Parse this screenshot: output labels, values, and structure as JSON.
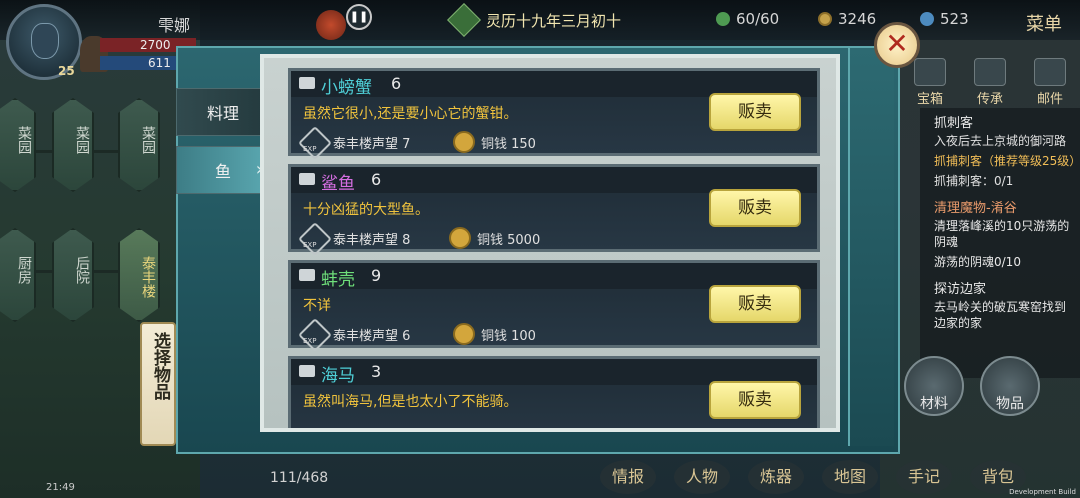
{
  "header": {
    "player_name": "雫娜",
    "level": "25",
    "hp": "2700",
    "mp": "611",
    "pause_icon": "pause-icon",
    "date": "灵历十九年三月初十",
    "resources": [
      {
        "icon": "stamina-icon",
        "value": "60/60"
      },
      {
        "icon": "coin-icon",
        "value": "3246"
      },
      {
        "icon": "spirit-icon",
        "value": "523"
      }
    ],
    "menu_label": "菜单"
  },
  "map": {
    "nodes": [
      "菜园",
      "菜园",
      "菜园",
      "厨房",
      "后院",
      "泰丰楼"
    ],
    "choose_label": "选择物品"
  },
  "modal": {
    "tabs": [
      {
        "label": "料理",
        "active": false
      },
      {
        "label": "鱼",
        "active": true
      }
    ],
    "items": [
      {
        "name": "小螃蟹",
        "qty": "6",
        "name_color": "#4fd0d8",
        "desc": "虽然它很小,还是要小心它的蟹钳。",
        "reputation": "泰丰楼声望 7",
        "price": "铜钱 150",
        "sell_label": "贩卖"
      },
      {
        "name": "鲨鱼",
        "qty": "6",
        "name_color": "#d46ee0",
        "desc": "十分凶猛的大型鱼。",
        "reputation": "泰丰楼声望 8",
        "price": "铜钱 5000",
        "sell_label": "贩卖"
      },
      {
        "name": "蚌壳",
        "qty": "9",
        "name_color": "#6fe07a",
        "desc": "不详",
        "reputation": "泰丰楼声望 6",
        "price": "铜钱 100",
        "sell_label": "贩卖"
      },
      {
        "name": "海马",
        "qty": "3",
        "name_color": "#4fd0d8",
        "desc": "虽然叫海马,但是也太小了不能骑。",
        "reputation": "",
        "price": "",
        "sell_label": "贩卖"
      }
    ],
    "exp_label": "EXP",
    "close_label": "✕"
  },
  "right": {
    "top_icons": [
      "宝箱",
      "传承",
      "邮件"
    ],
    "quests": [
      {
        "title": "抓刺客",
        "desc": "入夜后去上京城的御河路",
        "desc2": "抓捕刺客（推荐等级25级）",
        "progress": "抓捕刺客：0/1"
      },
      {
        "title": "清理魔物-淆谷",
        "desc": "清理落峰溪的10只游荡的阴魂",
        "progress": "游荡的阴魂0/10"
      },
      {
        "title": "探访边家",
        "desc": "去马岭关的破瓦寒窑找到边家的家"
      }
    ],
    "bag_buttons": [
      "材料",
      "物品"
    ]
  },
  "bottom": {
    "time": "21:49",
    "inventory_count": "111/468",
    "nav": [
      "情报",
      "人物",
      "炼器",
      "地图",
      "手记",
      "背包"
    ],
    "dev_build": "Development Build"
  }
}
